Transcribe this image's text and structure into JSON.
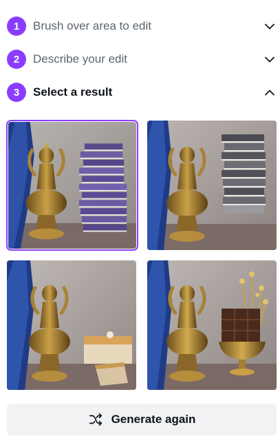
{
  "steps": [
    {
      "number": "1",
      "label": "Brush over area to edit",
      "icon": "chevron-down-icon"
    },
    {
      "number": "2",
      "label": "Describe your edit",
      "icon": "chevron-down-icon"
    },
    {
      "number": "3",
      "label": "Select a result",
      "icon": "chevron-up-icon"
    }
  ],
  "results": [
    {
      "selected": true,
      "content": "purple-book-stack"
    },
    {
      "selected": false,
      "content": "grey-book-stack"
    },
    {
      "selected": false,
      "content": "cake-slices"
    },
    {
      "selected": false,
      "content": "chocolate-in-gold-bowl"
    }
  ],
  "generate": {
    "label": "Generate again",
    "icon": "shuffle-icon"
  },
  "colors": {
    "accent": "#8b3dff",
    "button_bg": "#f1f2f4",
    "text": "#0e1318",
    "muted_text": "#5b6370"
  }
}
